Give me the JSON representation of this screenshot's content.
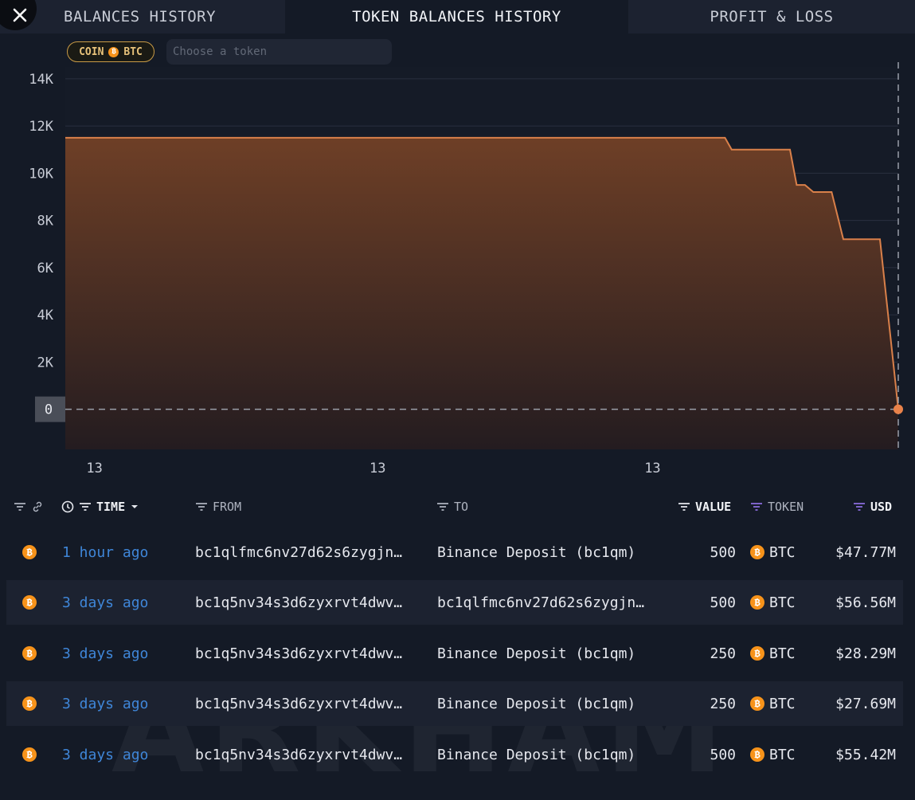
{
  "tabs": [
    {
      "label": "BALANCES HISTORY",
      "active": false
    },
    {
      "label": "TOKEN BALANCES HISTORY",
      "active": true
    },
    {
      "label": "PROFIT & LOSS",
      "active": false
    }
  ],
  "filter": {
    "chip_prefix": "COIN",
    "chip_symbol": "₿",
    "chip_token": "BTC",
    "token_placeholder": "Choose a token"
  },
  "chart_data": {
    "type": "area",
    "title": "",
    "xlabel": "",
    "ylabel": "",
    "y_ticks": [
      "14K",
      "12K",
      "10K",
      "8K",
      "6K",
      "4K",
      "2K",
      "0"
    ],
    "ylim": [
      -1700,
      14500
    ],
    "x_tick_labels": [
      "13",
      "13",
      "13"
    ],
    "x_tick_positions": [
      0.035,
      0.375,
      0.705
    ],
    "grid": true,
    "current_value_label": "0",
    "points": [
      [
        0,
        11500
      ],
      [
        0.792,
        11500
      ],
      [
        0.8,
        11000
      ],
      [
        0.87,
        11000
      ],
      [
        0.878,
        9500
      ],
      [
        0.888,
        9500
      ],
      [
        0.898,
        9200
      ],
      [
        0.92,
        9200
      ],
      [
        0.934,
        7200
      ],
      [
        0.978,
        7200
      ],
      [
        1.0,
        0
      ]
    ],
    "colors": {
      "line": "#d9804a",
      "fill_top": "#6e3f26",
      "fill_bottom": "#241c20",
      "marker": "#e9824a"
    }
  },
  "table": {
    "headers": {
      "time": "TIME",
      "from": "FROM",
      "to": "TO",
      "value": "VALUE",
      "token": "TOKEN",
      "usd": "USD"
    },
    "rows": [
      {
        "time": "1 hour ago",
        "from": "bc1qlfmc6nv27d62s6zygjn…",
        "to": "Binance Deposit (bc1qm)",
        "value": "500",
        "token": "BTC",
        "usd": "$47.77M"
      },
      {
        "time": "3 days ago",
        "from": "bc1q5nv34s3d6zyxrvt4dwv…",
        "to": "bc1qlfmc6nv27d62s6zygjn…",
        "value": "500",
        "token": "BTC",
        "usd": "$56.56M"
      },
      {
        "time": "3 days ago",
        "from": "bc1q5nv34s3d6zyxrvt4dwv…",
        "to": "Binance Deposit (bc1qm)",
        "value": "250",
        "token": "BTC",
        "usd": "$28.29M"
      },
      {
        "time": "3 days ago",
        "from": "bc1q5nv34s3d6zyxrvt4dwv…",
        "to": "Binance Deposit (bc1qm)",
        "value": "250",
        "token": "BTC",
        "usd": "$27.69M"
      },
      {
        "time": "3 days ago",
        "from": "bc1q5nv34s3d6zyxrvt4dwv…",
        "to": "Binance Deposit (bc1qm)",
        "value": "500",
        "token": "BTC",
        "usd": "$55.42M"
      }
    ]
  },
  "watermark": "ARKHAM",
  "colors": {
    "accent_orange": "#f7931a",
    "link_blue": "#3f86d8",
    "sort_purple": "#8a6ce0"
  }
}
